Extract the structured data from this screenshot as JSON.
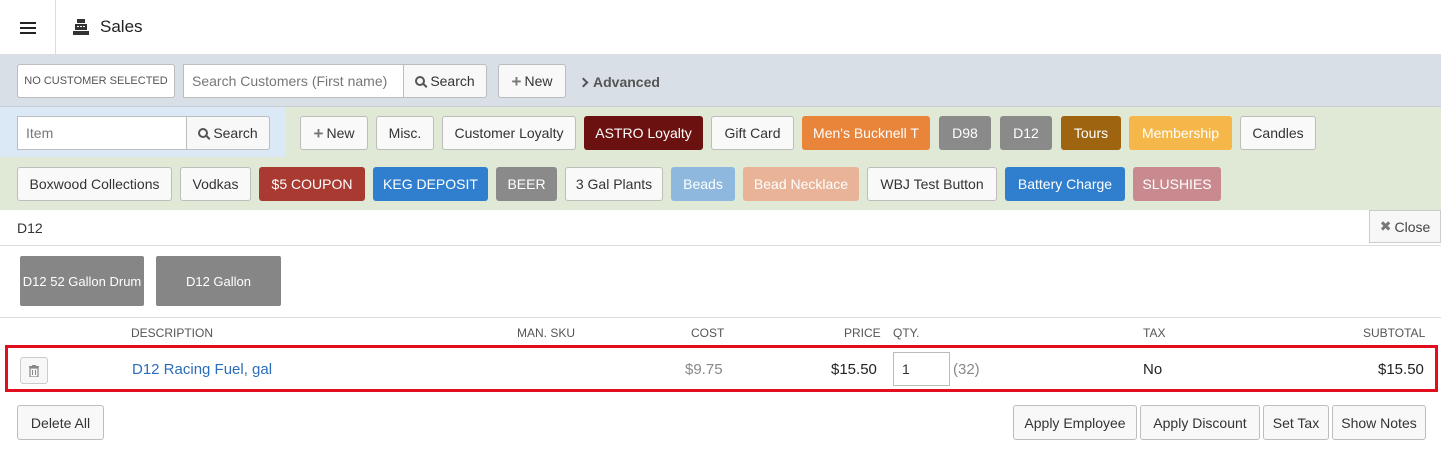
{
  "header": {
    "title": "Sales",
    "menu_icon": "hamburger-icon",
    "title_icon": "cash-register-icon"
  },
  "customer_bar": {
    "no_customer_label": "NO CUSTOMER SELECTED",
    "search_placeholder": "Search Customers (First name)",
    "search_label": "Search",
    "new_label": "New",
    "advanced_label": "Advanced"
  },
  "item_search": {
    "placeholder": "Item",
    "search_label": "Search"
  },
  "quick_buttons": {
    "new": "New",
    "misc": "Misc.",
    "customer_loyalty": "Customer Loyalty",
    "astro_loyalty": "ASTRO Loyalty",
    "gift_card": "Gift Card",
    "mens_bucknell_t": "Men's Bucknell T",
    "d98": "D98",
    "d12": "D12",
    "tours": "Tours",
    "membership": "Membership",
    "candles": "Candles",
    "boxwood": "Boxwood Collections",
    "vodkas": "Vodkas",
    "coupon5": "$5 COUPON",
    "keg_deposit": "KEG DEPOSIT",
    "beer": "BEER",
    "gal_plants": "3 Gal Plants",
    "beads": "Beads",
    "bead_necklace": "Bead Necklace",
    "wbj_test": "WBJ Test Button",
    "battery_charge": "Battery Charge",
    "slushies": "SLUSHIES"
  },
  "colors": {
    "astro": "#6b1210",
    "mens": "#e8853a",
    "gray": "#8a8a8a",
    "tours": "#9e6410",
    "membership": "#f5b74a",
    "coupon": "#a83a32",
    "keg": "#2f7fce",
    "beads": "#8fb8de",
    "necklace": "#e8b396",
    "battery": "#2f7fce",
    "slushies": "#c98a8f",
    "highlight": "#e00e1e"
  },
  "category": {
    "title": "D12",
    "close_label": "Close",
    "products": [
      "D12 52 Gallon Drum",
      "D12 Gallon"
    ]
  },
  "table": {
    "headers": {
      "description": "DESCRIPTION",
      "man_sku": "MAN. SKU",
      "cost": "COST",
      "price": "PRICE",
      "qty": "QTY.",
      "tax": "TAX",
      "subtotal": "SUBTOTAL"
    },
    "rows": [
      {
        "description": "D12 Racing Fuel, gal",
        "man_sku": "",
        "cost": "$9.75",
        "price": "$15.50",
        "qty": "1",
        "stock": "(32)",
        "tax": "No",
        "subtotal": "$15.50"
      }
    ]
  },
  "footer": {
    "delete_all": "Delete All",
    "apply_employee": "Apply Employee",
    "apply_discount": "Apply Discount",
    "set_tax": "Set Tax",
    "show_notes": "Show Notes"
  }
}
